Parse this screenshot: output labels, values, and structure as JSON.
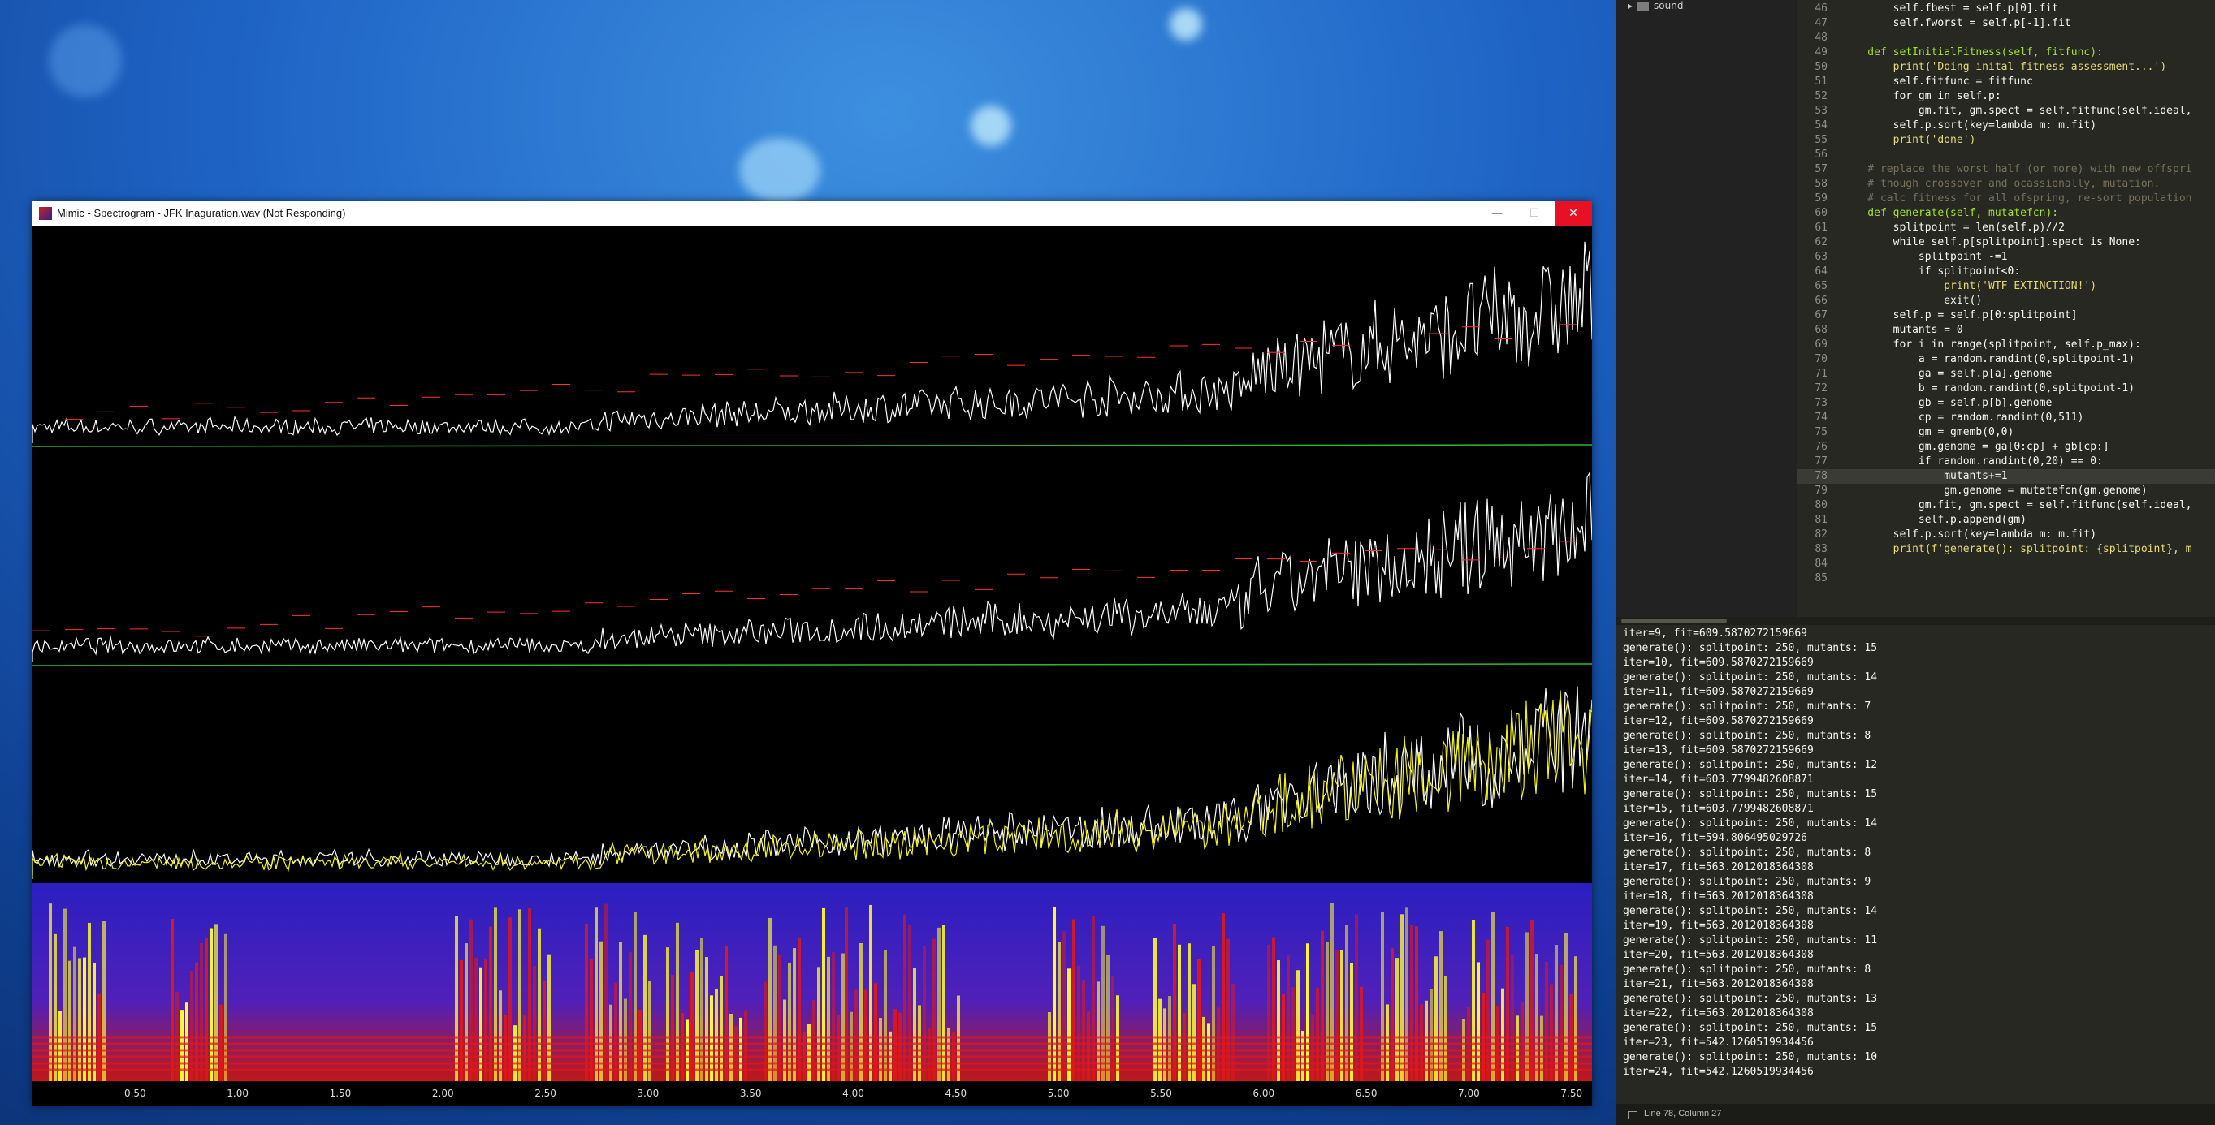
{
  "window": {
    "title": "Mimic - Spectrogram - JFK Inaguration.wav (Not Responding)",
    "minimize_label": "—",
    "maximize_label": "☐",
    "close_label": "✕"
  },
  "time_axis": {
    "ticks": [
      "0.50",
      "1.00",
      "1.50",
      "2.00",
      "2.50",
      "3.00",
      "3.50",
      "4.00",
      "4.50",
      "5.00",
      "5.50",
      "6.00",
      "6.50",
      "7.00",
      "7.50"
    ],
    "start": 0.0,
    "end": 7.6
  },
  "colors": {
    "waveform": "#ffffff",
    "overlay_yellow": "#f2f21a",
    "peak_red": "#ff3030",
    "peak_blue": "#5050ff",
    "threshold_green": "#2eb82e",
    "spectrogram_low": "#2222cc",
    "spectrogram_mid": "#e01818",
    "spectrogram_high": "#ffff30"
  },
  "editor": {
    "sidebar_folder": "sound",
    "code_lines": [
      {
        "n": "46",
        "text": "        self.fbest = self.p[0].fit"
      },
      {
        "n": "47",
        "text": "        self.fworst = self.p[-1].fit"
      },
      {
        "n": "48",
        "text": ""
      },
      {
        "n": "49",
        "text": "    def setInitialFitness(self, fitfunc):"
      },
      {
        "n": "50",
        "text": "        print('Doing inital fitness assessment...')"
      },
      {
        "n": "51",
        "text": "        self.fitfunc = fitfunc"
      },
      {
        "n": "52",
        "text": "        for gm in self.p:"
      },
      {
        "n": "53",
        "text": "            gm.fit, gm.spect = self.fitfunc(self.ideal,"
      },
      {
        "n": "54",
        "text": "        self.p.sort(key=lambda m: m.fit)"
      },
      {
        "n": "55",
        "text": "        print('done')"
      },
      {
        "n": "56",
        "text": ""
      },
      {
        "n": "57",
        "text": "    # replace the worst half (or more) with new offspri"
      },
      {
        "n": "58",
        "text": "    # though crossover and ocassionally, mutation."
      },
      {
        "n": "59",
        "text": "    # calc fitness for all ofspring, re-sort population"
      },
      {
        "n": "60",
        "text": "    def generate(self, mutatefcn):"
      },
      {
        "n": "61",
        "text": "        splitpoint = len(self.p)//2"
      },
      {
        "n": "62",
        "text": "        while self.p[splitpoint].spect is None:"
      },
      {
        "n": "63",
        "text": "            splitpoint -=1"
      },
      {
        "n": "64",
        "text": "            if splitpoint<0:"
      },
      {
        "n": "65",
        "text": "                print('WTF EXTINCTION!')"
      },
      {
        "n": "66",
        "text": "                exit()"
      },
      {
        "n": "67",
        "text": "        self.p = self.p[0:splitpoint]"
      },
      {
        "n": "68",
        "text": "        mutants = 0"
      },
      {
        "n": "69",
        "text": "        for i in range(splitpoint, self.p_max):"
      },
      {
        "n": "70",
        "text": "            a = random.randint(0,splitpoint-1)"
      },
      {
        "n": "71",
        "text": "            ga = self.p[a].genome"
      },
      {
        "n": "72",
        "text": "            b = random.randint(0,splitpoint-1)"
      },
      {
        "n": "73",
        "text": "            gb = self.p[b].genome"
      },
      {
        "n": "74",
        "text": "            cp = random.randint(0,511)"
      },
      {
        "n": "75",
        "text": "            gm = gmemb(0,0)"
      },
      {
        "n": "76",
        "text": "            gm.genome = ga[0:cp] + gb[cp:]"
      },
      {
        "n": "77",
        "text": "            if random.randint(0,20) == 0:"
      },
      {
        "n": "78",
        "text": "                mutants+=1"
      },
      {
        "n": "79",
        "text": "                gm.genome = mutatefcn(gm.genome)"
      },
      {
        "n": "80",
        "text": "            gm.fit, gm.spect = self.fitfunc(self.ideal,"
      },
      {
        "n": "81",
        "text": "            self.p.append(gm)"
      },
      {
        "n": "82",
        "text": "        self.p.sort(key=lambda m: m.fit)"
      },
      {
        "n": "83",
        "text": "        print(f'generate(): splitpoint: {splitpoint}, m"
      },
      {
        "n": "84",
        "text": ""
      },
      {
        "n": "85",
        "text": ""
      }
    ],
    "console_lines": [
      "iter=9, fit=609.5870272159669",
      "generate(): splitpoint: 250, mutants: 15",
      "iter=10, fit=609.5870272159669",
      "generate(): splitpoint: 250, mutants: 14",
      "iter=11, fit=609.5870272159669",
      "generate(): splitpoint: 250, mutants: 7",
      "iter=12, fit=609.5870272159669",
      "generate(): splitpoint: 250, mutants: 8",
      "iter=13, fit=609.5870272159669",
      "generate(): splitpoint: 250, mutants: 12",
      "iter=14, fit=603.7799482608871",
      "generate(): splitpoint: 250, mutants: 15",
      "iter=15, fit=603.7799482608871",
      "generate(): splitpoint: 250, mutants: 14",
      "iter=16, fit=594.806495029726",
      "generate(): splitpoint: 250, mutants: 8",
      "iter=17, fit=563.2012018364308",
      "generate(): splitpoint: 250, mutants: 9",
      "iter=18, fit=563.2012018364308",
      "generate(): splitpoint: 250, mutants: 14",
      "iter=19, fit=563.2012018364308",
      "generate(): splitpoint: 250, mutants: 11",
      "iter=20, fit=563.2012018364308",
      "generate(): splitpoint: 250, mutants: 8",
      "iter=21, fit=563.2012018364308",
      "generate(): splitpoint: 250, mutants: 13",
      "iter=22, fit=563.2012018364308",
      "generate(): splitpoint: 250, mutants: 15",
      "iter=23, fit=542.1260519934456",
      "generate(): splitpoint: 250, mutants: 10",
      "iter=24, fit=542.1260519934456"
    ],
    "status": "Line 78, Column 27"
  }
}
